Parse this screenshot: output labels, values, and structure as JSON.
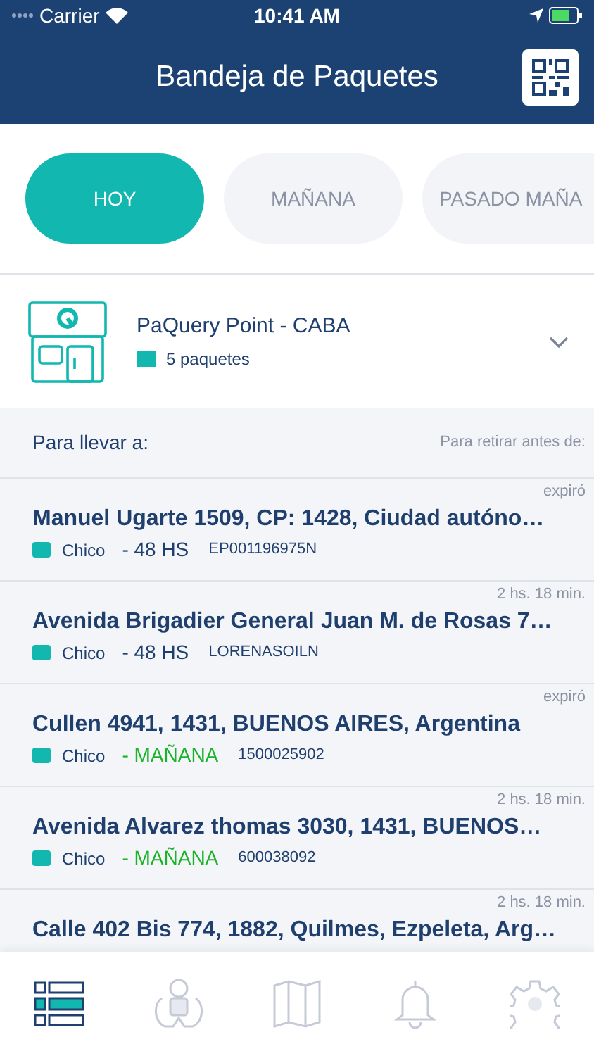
{
  "status_bar": {
    "carrier": "Carrier",
    "time": "10:41 AM"
  },
  "header": {
    "title": "Bandeja de Paquetes"
  },
  "tabs": [
    {
      "label": "HOY",
      "selected": true
    },
    {
      "label": "MAÑANA",
      "selected": false
    },
    {
      "label": "PASADO MAÑA",
      "selected": false
    }
  ],
  "point": {
    "name": "PaQuery Point - CABA",
    "count": "5 paquetes",
    "expanded": false
  },
  "list_header": {
    "left": "Para llevar a:",
    "right": "Para retirar antes de:"
  },
  "rows": [
    {
      "deadline": "expiró",
      "address": "Manuel Ugarte 1509, CP: 1428, Ciudad autóno…",
      "size": "Chico",
      "urgency": "- 48 HS",
      "color": "#1f3f6e",
      "code": "EP001196975N"
    },
    {
      "deadline": "2 hs. 18 min.",
      "address": "Avenida Brigadier General Juan M. de Rosas 7…",
      "size": "Chico",
      "urgency": "- 48 HS",
      "color": "#1f3f6e",
      "code": "LORENASOILN"
    },
    {
      "deadline": "expiró",
      "address": "Cullen 4941, 1431, BUENOS AIRES, Argentina",
      "size": "Chico",
      "urgency": "- MAÑANA",
      "color": "#1bb32a",
      "code": "1500025902"
    },
    {
      "deadline": "2 hs. 18 min.",
      "address": "Avenida Alvarez thomas  3030, 1431, BUENOS…",
      "size": "Chico",
      "urgency": "- MAÑANA",
      "color": "#1bb32a",
      "code": "600038092"
    },
    {
      "deadline": "2 hs. 18 min.",
      "address": "Calle 402 Bis 774, 1882, Quilmes, Ezpeleta, Arg…"
    }
  ],
  "tab_bar": [
    {
      "selected": true
    },
    {
      "selected": false
    },
    {
      "selected": false
    },
    {
      "selected": false
    },
    {
      "selected": false
    }
  ]
}
